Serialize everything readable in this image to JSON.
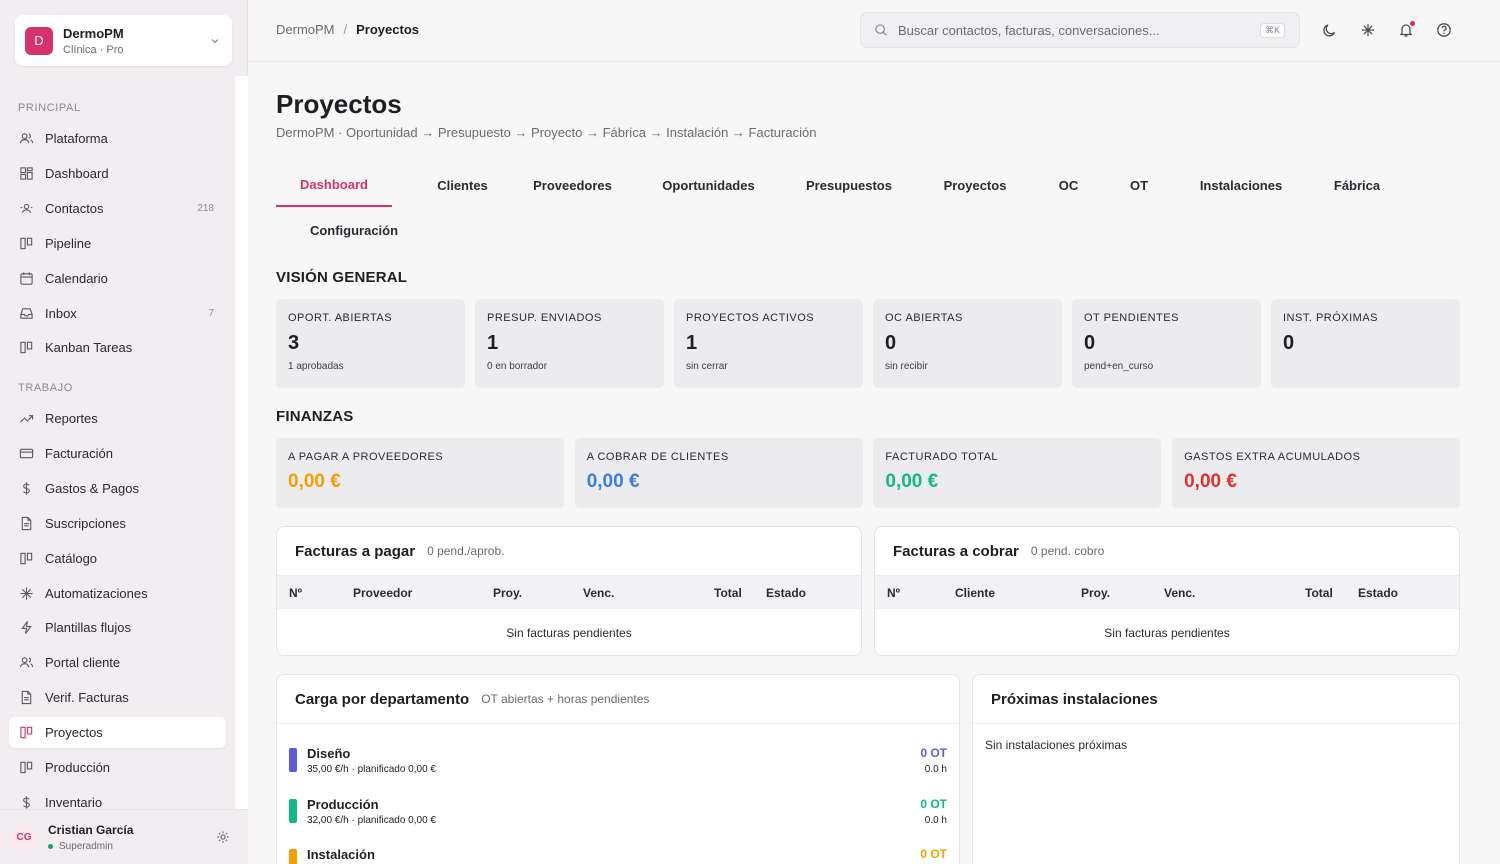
{
  "org": {
    "initial": "D",
    "name": "DermoPM",
    "plan": "Clínica · Pro"
  },
  "nav": {
    "sections": [
      "PRINCIPAL",
      "TRABAJO"
    ],
    "principal": [
      {
        "label": "Plataforma",
        "icon": "users-icon"
      },
      {
        "label": "Dashboard",
        "icon": "grid-icon"
      },
      {
        "label": "Contactos",
        "icon": "contacts-icon",
        "count": "218"
      },
      {
        "label": "Pipeline",
        "icon": "columns-icon"
      },
      {
        "label": "Calendario",
        "icon": "calendar-icon"
      },
      {
        "label": "Inbox",
        "icon": "inbox-icon",
        "count": "7"
      },
      {
        "label": "Kanban Tareas",
        "icon": "columns-icon"
      }
    ],
    "trabajo": [
      {
        "label": "Reportes",
        "icon": "trend-icon"
      },
      {
        "label": "Facturación",
        "icon": "card-icon"
      },
      {
        "label": "Gastos & Pagos",
        "icon": "euro-icon"
      },
      {
        "label": "Suscripciones",
        "icon": "document-icon"
      },
      {
        "label": "Catálogo",
        "icon": "columns-icon"
      },
      {
        "label": "Automatizaciones",
        "icon": "sparkle-icon"
      },
      {
        "label": "Plantillas flujos",
        "icon": "bolt-icon"
      },
      {
        "label": "Portal cliente",
        "icon": "users-icon"
      },
      {
        "label": "Verif. Facturas",
        "icon": "document-icon"
      },
      {
        "label": "Proyectos",
        "icon": "columns-icon",
        "active": true
      },
      {
        "label": "Producción",
        "icon": "columns-icon"
      },
      {
        "label": "Inventario",
        "icon": "euro-icon"
      }
    ]
  },
  "user": {
    "initials": "CG",
    "name": "Cristian García",
    "role": "Superadmin"
  },
  "topbar": {
    "breadcrumb": [
      "DermoPM",
      "Proyectos"
    ],
    "search_placeholder": "Buscar contactos, facturas, conversaciones...",
    "shortcut": "⌘K"
  },
  "page": {
    "title": "Proyectos",
    "subtitle": "DermoPM · Oportunidad → Presupuesto → Proyecto → Fábrica → Instalación → Facturación"
  },
  "tabs": [
    "Dashboard",
    "Clientes",
    "Proveedores",
    "Oportunidades",
    "Presupuestos",
    "Proyectos",
    "OC",
    "OT",
    "Instalaciones",
    "Fábrica",
    "Configuración"
  ],
  "overview": {
    "title": "VISIÓN GENERAL",
    "kpis": [
      {
        "label": "OPORT. ABIERTAS",
        "value": "3",
        "note": "1 aprobadas"
      },
      {
        "label": "PRESUP. ENVIADOS",
        "value": "1",
        "note": "0 en borrador"
      },
      {
        "label": "PROYECTOS ACTIVOS",
        "value": "1",
        "note": "sin cerrar"
      },
      {
        "label": "OC ABIERTAS",
        "value": "0",
        "note": "sin recibir"
      },
      {
        "label": "OT PENDIENTES",
        "value": "0",
        "note": "pend+en_curso"
      },
      {
        "label": "INST. PRÓXIMAS",
        "value": "0",
        "note": ""
      }
    ]
  },
  "finance": {
    "title": "FINANZAS",
    "items": [
      {
        "label": "A PAGAR A PROVEEDORES",
        "value": "0,00 €",
        "color": "#f59f00"
      },
      {
        "label": "A COBRAR DE CLIENTES",
        "value": "0,00 €",
        "color": "#3b7ddd"
      },
      {
        "label": "FACTURADO TOTAL",
        "value": "0,00 €",
        "color": "#12b886"
      },
      {
        "label": "GASTOS EXTRA ACUMULADOS",
        "value": "0,00 €",
        "color": "#e03131"
      }
    ]
  },
  "payables": {
    "title": "Facturas a pagar",
    "subtitle": "0 pend./aprob.",
    "columns": [
      "Nº",
      "Proveedor",
      "Proy.",
      "Venc.",
      "Total",
      "Estado"
    ],
    "empty": "Sin facturas pendientes"
  },
  "receivables": {
    "title": "Facturas a cobrar",
    "subtitle": "0 pend. cobro",
    "columns": [
      "Nº",
      "Cliente",
      "Proy.",
      "Venc.",
      "Total",
      "Estado"
    ],
    "empty": "Sin facturas pendientes"
  },
  "load": {
    "title": "Carga por departamento",
    "subtitle": "OT abiertas + horas pendientes",
    "departments": [
      {
        "name": "Diseño",
        "rate": "35,00 €/h · planificado 0,00 €",
        "ot": "0 OT",
        "hours": "0.0 h",
        "color": "#5c5ce0"
      },
      {
        "name": "Producción",
        "rate": "32,00 €/h · planificado 0,00 €",
        "ot": "0 OT",
        "hours": "0.0 h",
        "color": "#12b886"
      },
      {
        "name": "Instalación",
        "rate": "",
        "ot": "0 OT",
        "hours": "",
        "color": "#f59f00"
      }
    ]
  },
  "installs": {
    "title": "Próximas instalaciones",
    "empty": "Sin instalaciones próximas"
  }
}
